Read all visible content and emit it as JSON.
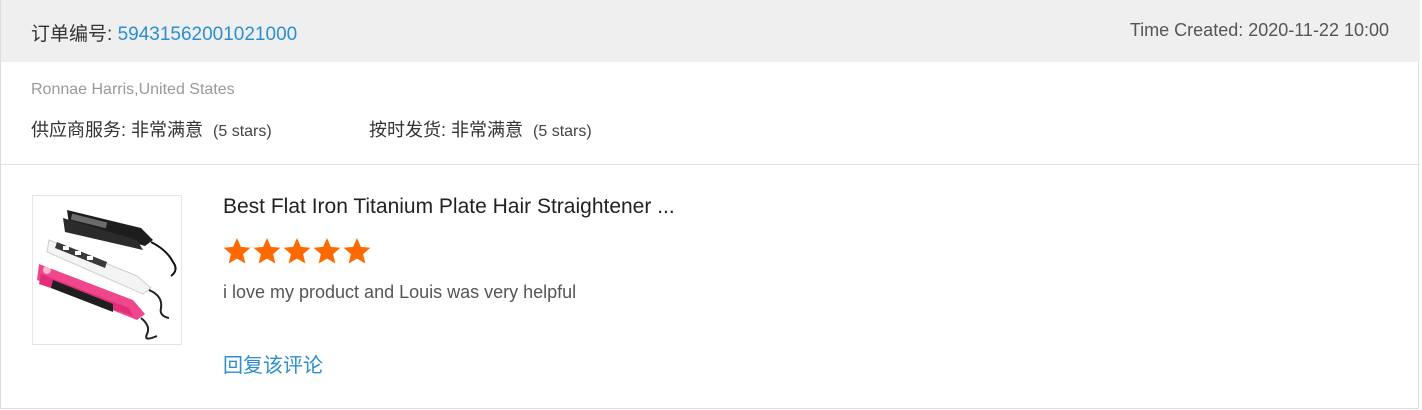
{
  "order": {
    "label": "订单编号: ",
    "number": "59431562001021000",
    "time_created": "Time Created: 2020-11-22 10:00"
  },
  "buyer": {
    "info": "Ronnae Harris,United States"
  },
  "ratings": [
    {
      "label": "供应商服务: 非常满意",
      "stars_text": "(5 stars)"
    },
    {
      "label": "按时发货: 非常满意",
      "stars_text": "(5 stars)"
    }
  ],
  "product": {
    "title": "Best Flat Iron Titanium Plate Hair Straightener ...",
    "image_icon": "hair-straightener-image",
    "rating": 5,
    "rating_max": 5,
    "star_color": "#ff6a00"
  },
  "review": {
    "text": "i love my product and Louis was very helpful"
  },
  "reply": {
    "label": "回复该评论"
  },
  "colors": {
    "link": "#2a8fd0",
    "header_bg": "#efefef",
    "star": "#ff6a00"
  }
}
